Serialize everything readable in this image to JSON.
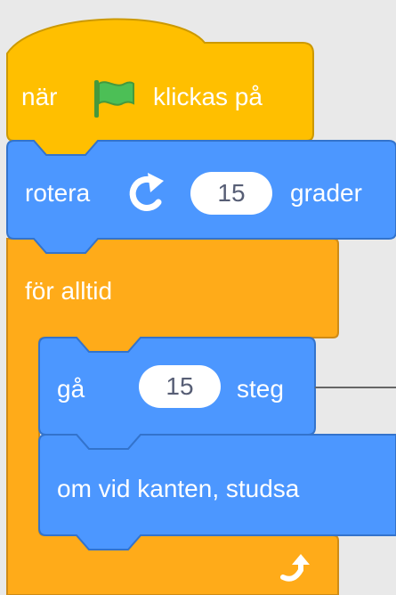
{
  "blocks": {
    "hat": {
      "prefix": "när",
      "flag_icon": "green-flag-icon",
      "suffix": "klickas på",
      "color": "#ffbf00"
    },
    "turn": {
      "prefix": "rotera",
      "icon": "rotate-right-icon",
      "value": "15",
      "suffix": "grader",
      "color": "#4c97ff"
    },
    "forever": {
      "label": "för alltid",
      "loop_icon": "loop-arrow-icon",
      "color": "#ffab19"
    },
    "move": {
      "prefix": "gå",
      "value": "15",
      "suffix": "steg",
      "color": "#4c97ff"
    },
    "bounce": {
      "label": "om vid kanten, studsa",
      "color": "#4c97ff"
    }
  }
}
